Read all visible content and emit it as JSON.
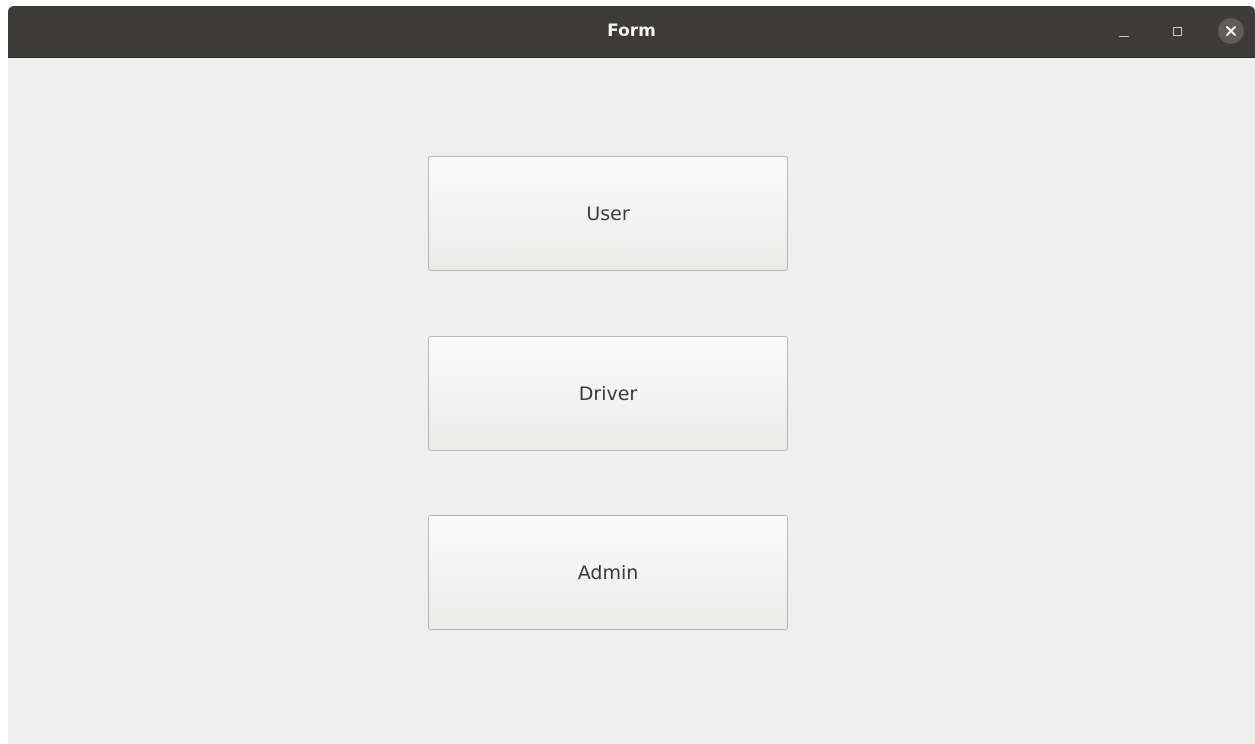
{
  "window": {
    "title": "Form"
  },
  "controls": {
    "minimize": "minimize-icon",
    "maximize": "maximize-icon",
    "close": "close-icon"
  },
  "buttons": {
    "user": "User",
    "driver": "Driver",
    "admin": "Admin"
  },
  "colors": {
    "titlebar": "#3c3b37",
    "background": "#efefef",
    "button_text": "#3a3a3a"
  }
}
